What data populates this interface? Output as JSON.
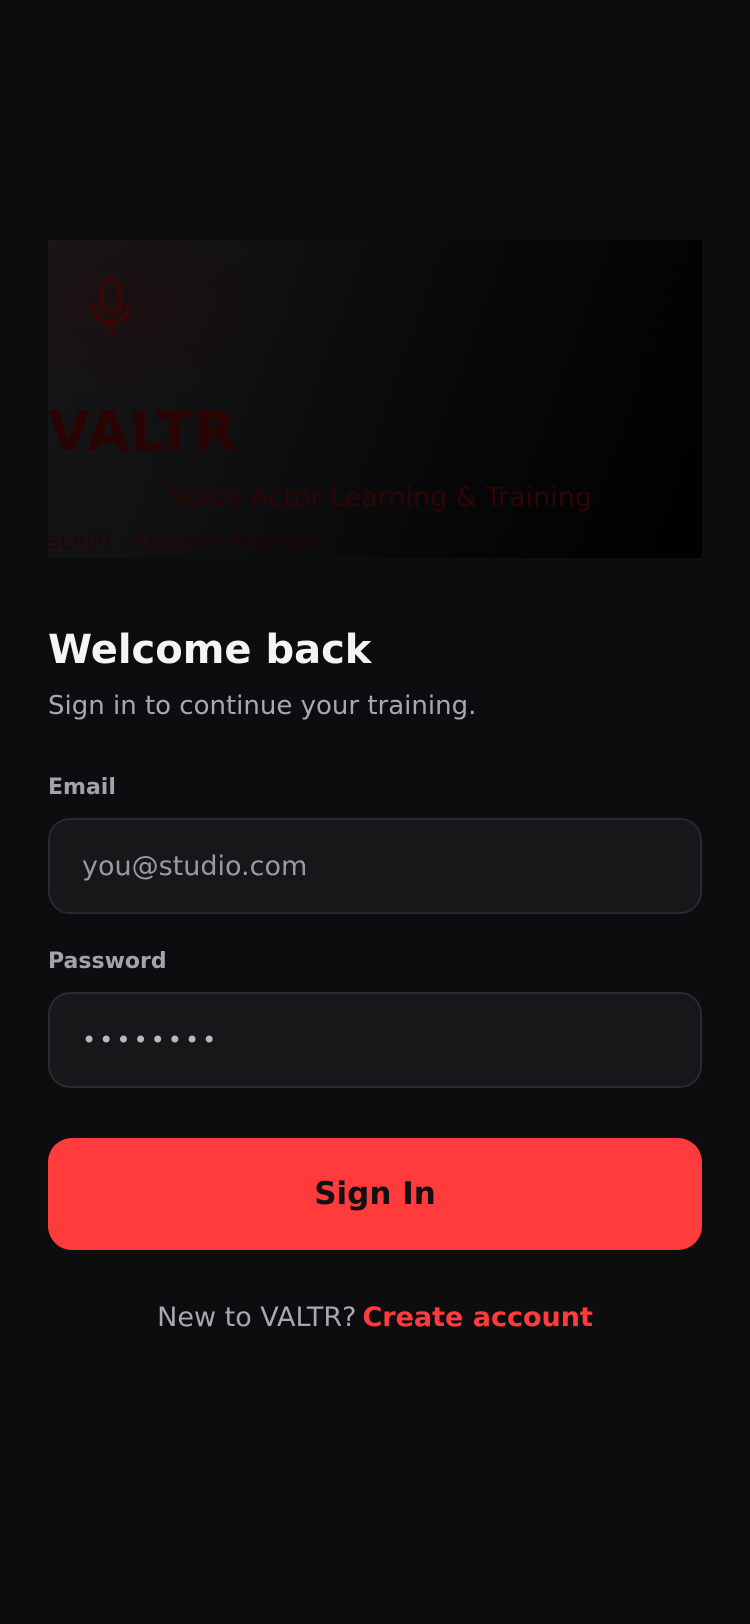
{
  "hero": {
    "brand": "VALTR",
    "tagline": "Voice Actor Learning & Training",
    "caption": "SCRIPT · RECORD · PERFORM",
    "icon": "microphone-icon"
  },
  "header": {
    "title": "Welcome back",
    "subtitle": "Sign in to continue your training."
  },
  "form": {
    "email_label": "Email",
    "email_placeholder": "you@studio.com",
    "email_value": "",
    "password_label": "Password",
    "password_value": "••••••••",
    "submit_label": "Sign In"
  },
  "footer": {
    "prompt": "New to VALTR?",
    "link_label": "Create account"
  },
  "colors": {
    "background": "#0d0d0f",
    "accent": "#ff3b3b",
    "field_bg": "#17171a",
    "field_border": "#2a2a2e",
    "muted_text": "#a8a8ae"
  }
}
